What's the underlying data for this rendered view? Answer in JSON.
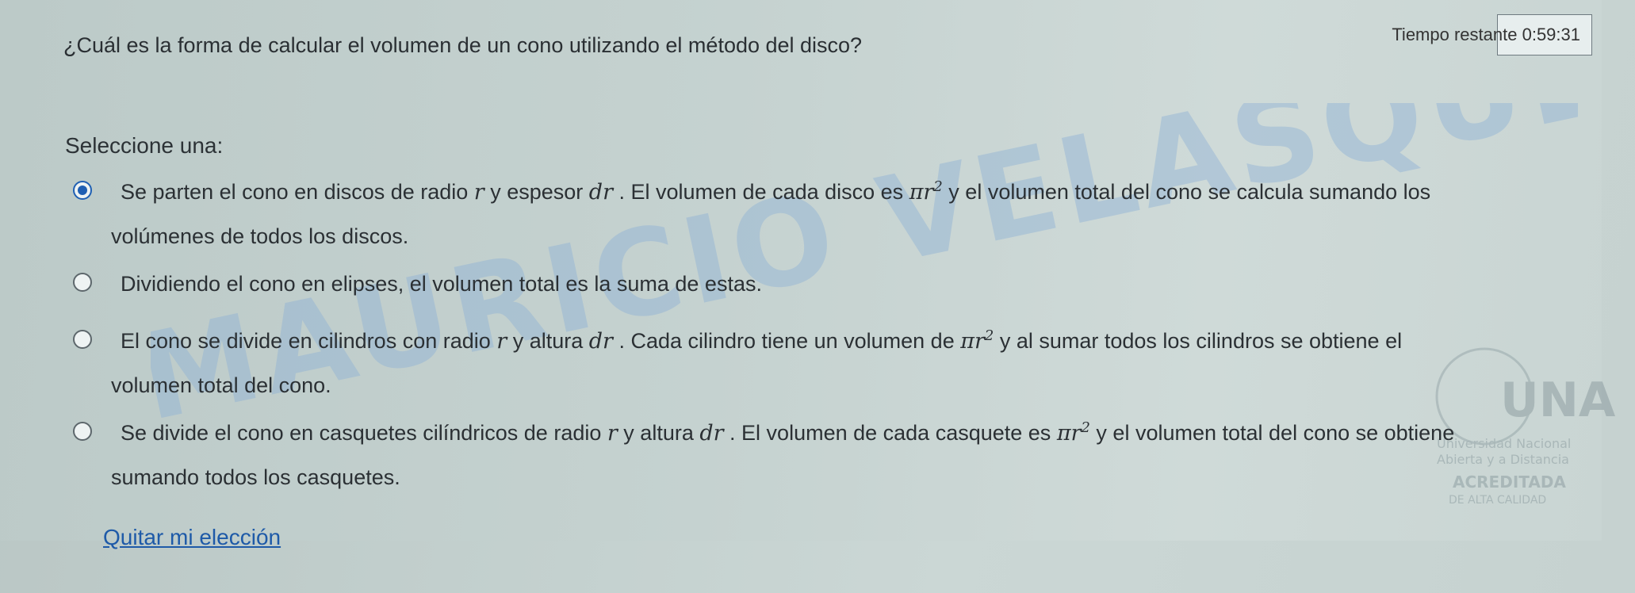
{
  "question": {
    "text": "¿Cuál es la forma de calcular el volumen de un cono utilizando el método del disco?"
  },
  "timer": {
    "label": "Tiempo restante",
    "value": "0:59:31"
  },
  "prompt": "Seleccione una:",
  "options": [
    {
      "checked": true,
      "parts": [
        "Se parten el cono en discos de radio ",
        "r",
        " y espesor ",
        "dr",
        " . El volumen de cada disco es ",
        "πr",
        "2",
        " y el volumen total del cono se calcula sumando los"
      ],
      "cont": "volúmenes de todos los discos."
    },
    {
      "checked": false,
      "parts": [
        "Dividiendo el cono en elipses, el volumen total es la suma de estas."
      ]
    },
    {
      "checked": false,
      "parts": [
        "El cono se divide en cilindros con radio ",
        "r",
        " y altura ",
        "dr",
        " . Cada cilindro tiene un volumen de ",
        "πr",
        "2",
        " y al sumar todos los cilindros se obtiene el"
      ],
      "cont": "volumen total del cono."
    },
    {
      "checked": false,
      "parts": [
        "Se divide el cono en casquetes cilíndricos de radio ",
        "r",
        " y altura ",
        "dr",
        " . El volumen de cada casquete es ",
        "πr",
        "2",
        " y el volumen total del cono se obtiene"
      ],
      "cont": "sumando todos los casquetes."
    }
  ],
  "clear_choice": "Quitar mi elección",
  "watermark": {
    "line1": "MAURICIO VELASQUEZ MEJIA"
  },
  "logo": {
    "name": "UNAD",
    "line1": "Universidad Nacional",
    "line2": "Abierta y a Distancia",
    "line3": "ACREDITADA",
    "line4": "DE ALTA CALIDAD"
  },
  "colors": {
    "accent": "#1f5fb3",
    "link": "#1e5aa8"
  }
}
